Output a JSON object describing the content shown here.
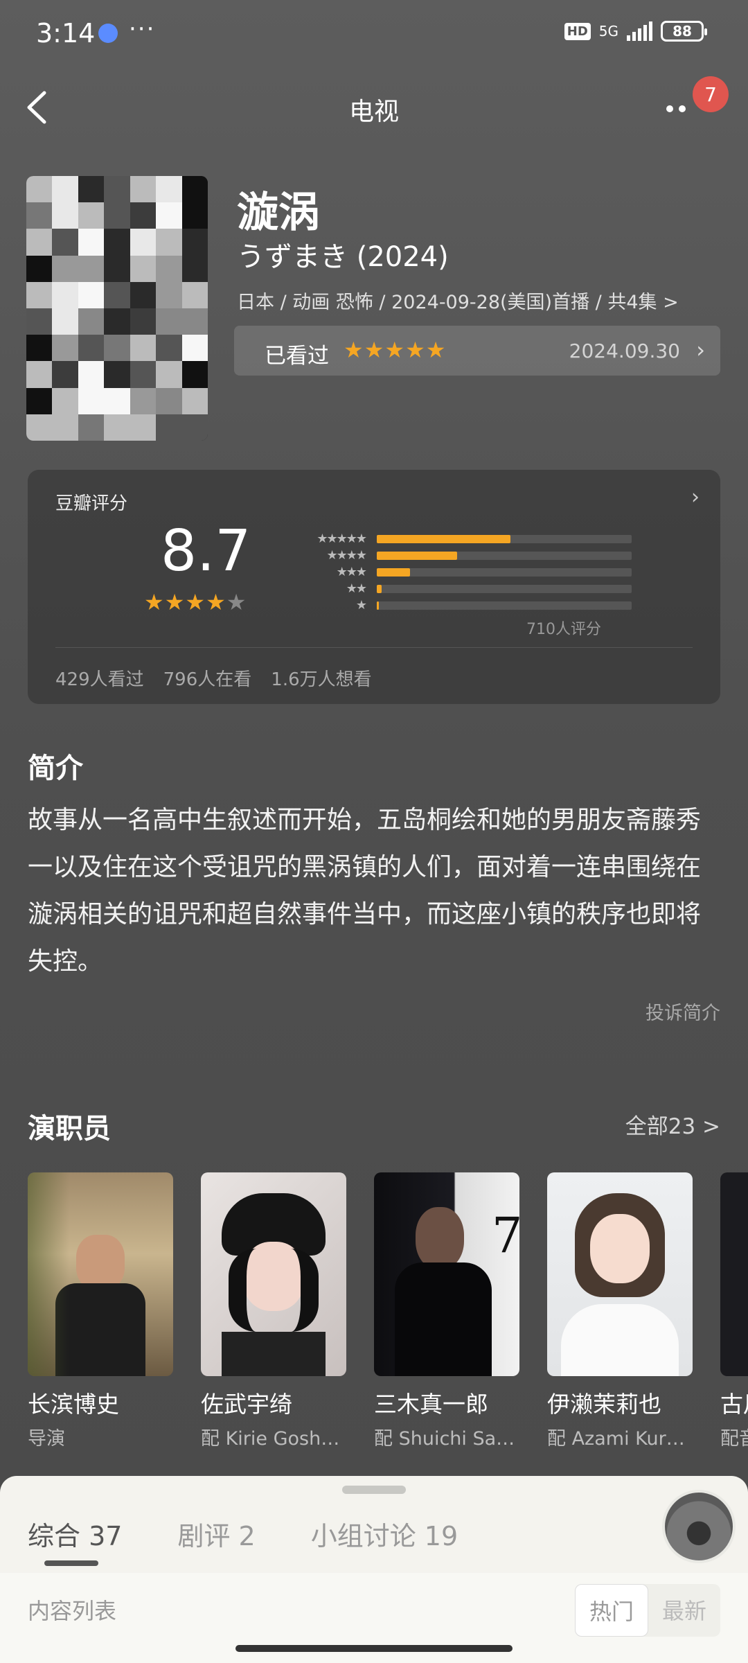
{
  "status_bar": {
    "time": "3:14",
    "battery": "88",
    "network": "5G",
    "hd": "HD",
    "more_dots": "···"
  },
  "nav": {
    "title": "电视",
    "badge_count": "7"
  },
  "show": {
    "title": "漩涡",
    "original_title": "うずまき (2024)",
    "meta": "日本 / 动画 恐怖 / 2024-09-28(美国)首播 / 共4集 >",
    "watched_label": "已看过",
    "watched_stars": "★★★★★",
    "watched_date": "2024.09.30"
  },
  "rating": {
    "title": "豆瓣评分",
    "score": "8.7",
    "stars_full": "★★★★",
    "stars_half": "★",
    "distribution": [
      {
        "stars": "★★★★★",
        "percent": 52.5
      },
      {
        "stars": "★★★★",
        "percent": 31.5
      },
      {
        "stars": "★★★",
        "percent": 13.0
      },
      {
        "stars": "★★",
        "percent": 1.8
      },
      {
        "stars": "★",
        "percent": 0.8
      }
    ],
    "count": "710人评分",
    "watched": "429人看过",
    "watching": "796人在看",
    "wish": "1.6万人想看"
  },
  "synopsis": {
    "title": "简介",
    "text": "故事从一名高中生叙述而开始，五岛桐绘和她的男朋友斋藤秀一以及住在这个受诅咒的黑涡镇的人们，面对着一连串围绕在漩涡相关的诅咒和超自然事件当中，而这座小镇的秩序也即将失控。",
    "report": "投诉简介"
  },
  "cast": {
    "title": "演职员",
    "all_label": "全部23 >",
    "members": [
      {
        "name": "长滨博史",
        "role": "导演"
      },
      {
        "name": "佐武宇绮",
        "role": "配 Kirie Gosh…"
      },
      {
        "name": "三木真一郎",
        "role": "配 Shuichi Sa…"
      },
      {
        "name": "伊濑茉莉也",
        "role": "配 Azami Kur…"
      },
      {
        "name": "古川",
        "role": "配音"
      }
    ]
  },
  "sheet": {
    "tabs": [
      {
        "label": "综合 37"
      },
      {
        "label": "剧评 2"
      },
      {
        "label": "小组讨论 19"
      }
    ],
    "content_label": "内容列表",
    "filter_hot": "热门",
    "filter_new": "最新"
  },
  "colors": {
    "accent_star": "#f5a623",
    "badge": "#e0564f",
    "sheet_bg": "#f4f3ee"
  }
}
